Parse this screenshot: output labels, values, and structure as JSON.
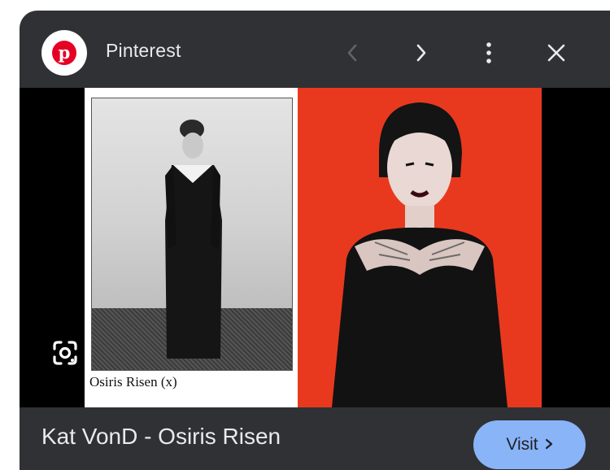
{
  "header": {
    "site_name": "Pinterest",
    "logo_letter": "p",
    "icons": {
      "logo": "pinterest-logo-icon",
      "previous": "chevron-left-icon",
      "next": "chevron-right-icon",
      "more": "more-vert-icon",
      "close": "close-icon",
      "lens": "google-lens-icon"
    }
  },
  "image": {
    "caption": "Osiris Risen (x)"
  },
  "result": {
    "title": "Kat VonD - Osiris Risen",
    "visit_label": "Visit"
  },
  "colors": {
    "panel_bg": "#303134",
    "text": "#e8eaed",
    "visit_bg": "#8ab4f8",
    "pinterest_red": "#e60023",
    "photo_backdrop": "#e8391f"
  }
}
